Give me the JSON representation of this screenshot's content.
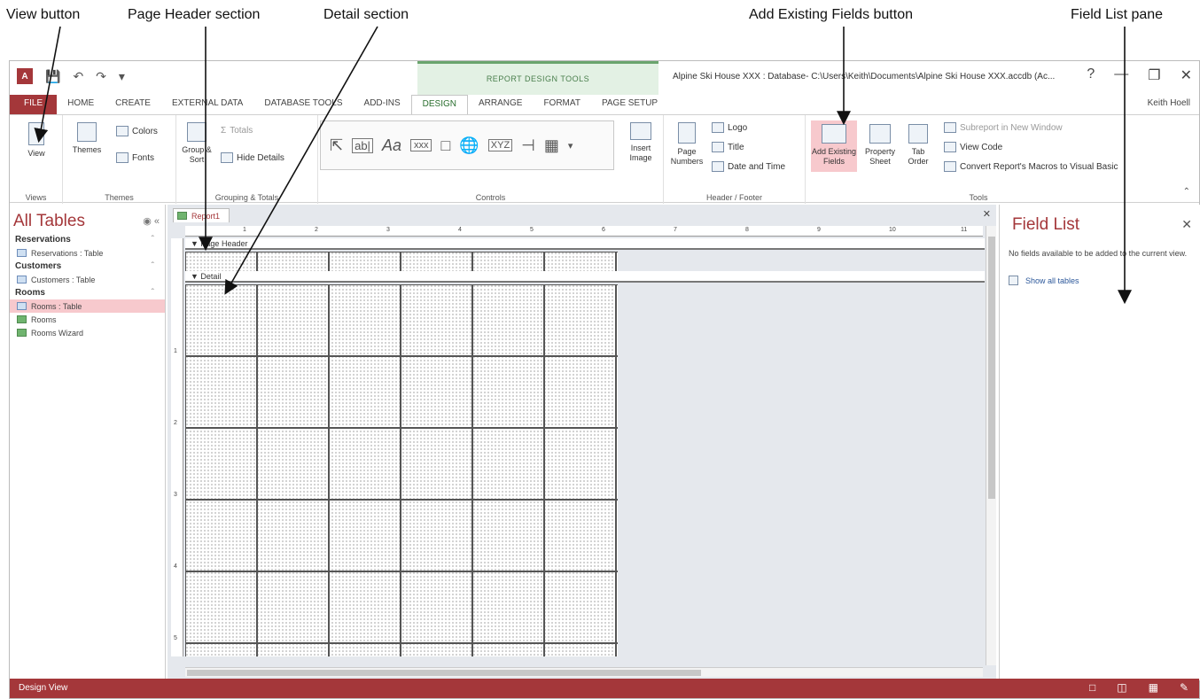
{
  "callouts": {
    "view_button": "View button",
    "page_header": "Page Header section",
    "detail": "Detail section",
    "add_fields": "Add Existing Fields button",
    "field_list": "Field List pane"
  },
  "titlebar": {
    "context_tab": "REPORT DESIGN TOOLS",
    "title": "Alpine Ski House XXX : Database- C:\\Users\\Keith\\Documents\\Alpine Ski House XXX.accdb (Ac...",
    "help": "?",
    "user": "Keith Hoell"
  },
  "tabs": [
    "FILE",
    "HOME",
    "CREATE",
    "EXTERNAL DATA",
    "DATABASE TOOLS",
    "ADD-INS",
    "DESIGN",
    "ARRANGE",
    "FORMAT",
    "PAGE SETUP"
  ],
  "ribbon": {
    "view": "View",
    "views_group": "Views",
    "themes": "Themes",
    "colors": "Colors",
    "fonts": "Fonts",
    "themes_group": "Themes",
    "group_sort": "Group & Sort",
    "totals": "Totals",
    "hide_details": "Hide Details",
    "grouping_group": "Grouping & Totals",
    "controls_group": "Controls",
    "insert_image": "Insert Image",
    "page_numbers": "Page Numbers",
    "logo": "Logo",
    "title": "Title",
    "date_time": "Date and Time",
    "header_group": "Header / Footer",
    "add_fields": "Add Existing Fields",
    "property_sheet": "Property Sheet",
    "tab_order": "Tab Order",
    "subreport": "Subreport in New Window",
    "view_code": "View Code",
    "convert": "Convert Report's Macros to Visual Basic",
    "tools_group": "Tools"
  },
  "nav": {
    "title": "All Tables",
    "groups": [
      {
        "name": "Reservations",
        "items": [
          "Reservations : Table"
        ]
      },
      {
        "name": "Customers",
        "items": [
          "Customers : Table"
        ]
      },
      {
        "name": "Rooms",
        "items": [
          "Rooms : Table",
          "Rooms",
          "Rooms Wizard"
        ]
      }
    ]
  },
  "document": {
    "tab": "Report1",
    "page_header": "Page Header",
    "detail": "Detail",
    "ruler_numbers": [
      "1",
      "2",
      "3",
      "4",
      "5",
      "6",
      "7",
      "8",
      "9",
      "10",
      "11"
    ],
    "vruler_numbers": [
      "1",
      "2",
      "3",
      "4",
      "5"
    ]
  },
  "fieldlist": {
    "title": "Field List",
    "message": "No fields available to be added to the current view.",
    "link": "Show all tables"
  },
  "status": {
    "text": "Design View"
  }
}
